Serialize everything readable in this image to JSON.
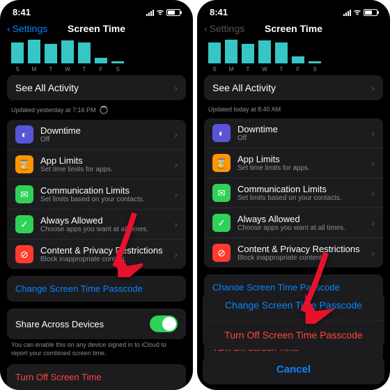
{
  "status": {
    "time": "8:41"
  },
  "nav": {
    "back": "Settings",
    "title": "Screen Time"
  },
  "barsA": [
    30,
    34,
    28,
    33,
    30,
    8,
    3
  ],
  "barsB": [
    30,
    34,
    28,
    33,
    30,
    10,
    3
  ],
  "days": [
    "S",
    "M",
    "T",
    "W",
    "T",
    "F",
    "S"
  ],
  "see_all": "See All Activity",
  "updatedA": "Updated yesterday at 7:16 PM",
  "updatedB": "Updated today at 8:40 AM",
  "items": [
    {
      "icon_bg": "#5856d6",
      "icon": "◐",
      "title": "Downtime",
      "sub": "Off"
    },
    {
      "icon_bg": "#ff9500",
      "icon": "⌛",
      "title": "App Limits",
      "sub": "Set time limits for apps."
    },
    {
      "icon_bg": "#30d158",
      "icon": "✉",
      "title": "Communication Limits",
      "sub": "Set limits based on your contacts."
    },
    {
      "icon_bg": "#30d158",
      "icon": "✓",
      "title": "Always Allowed",
      "sub": "Choose apps you want at all times."
    },
    {
      "icon_bg": "#ff3b30",
      "icon": "⊘",
      "title": "Content & Privacy Restrictions",
      "sub": "Block inappropriate content."
    }
  ],
  "change_pass": "Change Screen Time Passcode",
  "share": "Share Across Devices",
  "share_foot": "You can enable this on any device signed in to iCloud to report your combined screen time.",
  "turn_off": "Turn Off Screen Time",
  "sheet": {
    "change": "Change Screen Time Passcode",
    "off": "Turn Off Screen Time Passcode",
    "cancel": "Cancel"
  }
}
